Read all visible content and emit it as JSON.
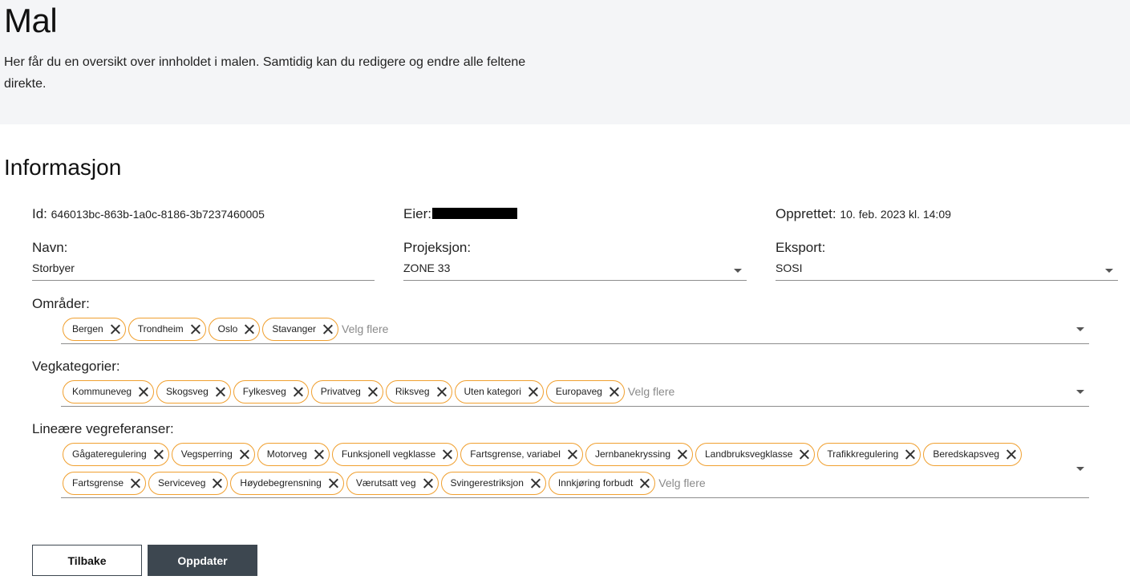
{
  "header": {
    "title": "Mal",
    "description": "Her får du en oversikt over innholdet i malen. Samtidig kan du redigere og endre alle feltene direkte."
  },
  "section": {
    "title": "Informasjon"
  },
  "info": {
    "id_label": "Id:",
    "id_value": "646013bc-863b-1a0c-8186-3b7237460005",
    "owner_label": "Eier:",
    "created_label": "Opprettet:",
    "created_value": "10. feb. 2023 kl. 14:09"
  },
  "fields": {
    "name_label": "Navn:",
    "name_value": "Storbyer",
    "projection_label": "Projeksjon:",
    "projection_value": "ZONE 33",
    "export_label": "Eksport:",
    "export_value": "SOSI"
  },
  "areas": {
    "label": "Områder:",
    "chips": [
      "Bergen",
      "Trondheim",
      "Oslo",
      "Stavanger"
    ],
    "placeholder": "Velg flere"
  },
  "road_categories": {
    "label": "Vegkategorier:",
    "chips": [
      "Kommuneveg",
      "Skogsveg",
      "Fylkesveg",
      "Privatveg",
      "Riksveg",
      "Uten kategori",
      "Europaveg"
    ],
    "placeholder": "Velg flere"
  },
  "linear_refs": {
    "label": "Lineære vegreferanser:",
    "chips_row1": [
      "Gågateregulering",
      "Vegsperring",
      "Motorveg",
      "Funksjonell vegklasse",
      "Fartsgrense, variabel",
      "Jernbanekryssing",
      "Landbruksvegklasse",
      "Trafikkregulering",
      "Beredskapsveg"
    ],
    "chips_row2": [
      "Fartsgrense",
      "Serviceveg",
      "Høydebegrensning",
      "Værutsatt veg",
      "Svingerestriksjon",
      "Innkjøring forbudt"
    ],
    "placeholder": "Velg flere"
  },
  "actions": {
    "back_label": "Tilbake",
    "update_label": "Oppdater"
  },
  "colors": {
    "chip_border": "#f0a030",
    "primary_button": "#3d4750",
    "hero_background": "#f4f5f7"
  },
  "icons": {
    "chip_remove": "close-icon",
    "dropdown": "caret-down-icon"
  }
}
